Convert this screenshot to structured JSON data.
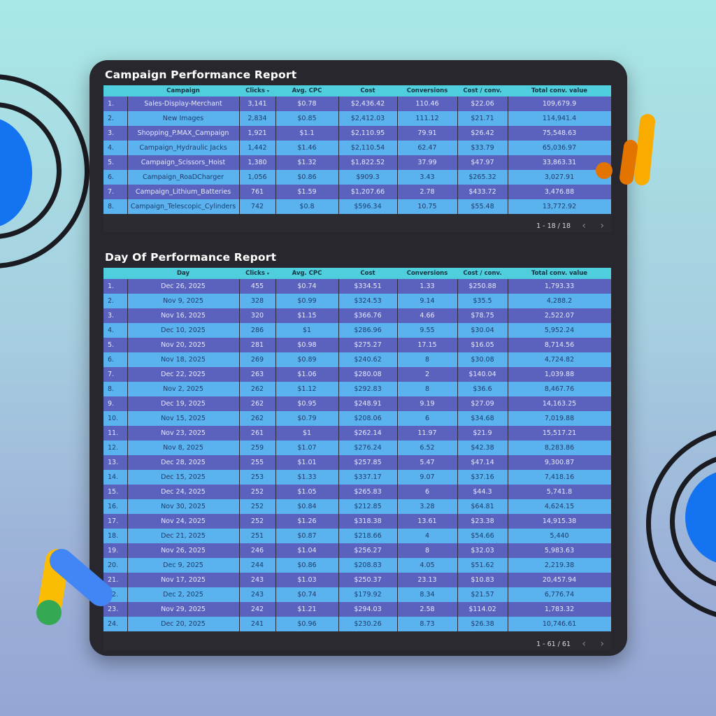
{
  "colors": {
    "panel": "#27272d",
    "header": "#4fcfde",
    "row_dark": "#5b62bd",
    "row_light": "#5ab2ee",
    "ads_blue": "#4285f4",
    "ads_yellow": "#fbbc04",
    "ads_green": "#34a853",
    "analytics_orange": "#e37400",
    "analytics_yellow": "#f9ab00"
  },
  "icons": {
    "google_ads": "google-ads-logo",
    "google_analytics": "google-analytics-logo",
    "prev": "chevron-left-icon",
    "next": "chevron-right-icon",
    "sort": "sort-down-icon"
  },
  "campaign_report": {
    "title": "Campaign Performance Report",
    "columns": [
      "Campaign",
      "Clicks",
      "Avg. CPC",
      "Cost",
      "Conversions",
      "Cost / conv.",
      "Total conv. value"
    ],
    "sort_marker": "▾",
    "rows": [
      [
        "1.",
        "Sales-Display-Merchant",
        "3,141",
        "$0.78",
        "$2,436.42",
        "110.46",
        "$22.06",
        "109,679.9"
      ],
      [
        "2.",
        "New Images",
        "2,834",
        "$0.85",
        "$2,412.03",
        "111.12",
        "$21.71",
        "114,941.4"
      ],
      [
        "3.",
        "Shopping_P.MAX_Campaign",
        "1,921",
        "$1.1",
        "$2,110.95",
        "79.91",
        "$26.42",
        "75,548.63"
      ],
      [
        "4.",
        "Campaign_Hydraulic Jacks",
        "1,442",
        "$1.46",
        "$2,110.54",
        "62.47",
        "$33.79",
        "65,036.97"
      ],
      [
        "5.",
        "Campaign_Scissors_Hoist",
        "1,380",
        "$1.32",
        "$1,822.52",
        "37.99",
        "$47.97",
        "33,863.31"
      ],
      [
        "6.",
        "Campaign_RoaDCharger",
        "1,056",
        "$0.86",
        "$909.3",
        "3.43",
        "$265.32",
        "3,027.91"
      ],
      [
        "7.",
        "Campaign_Lithium_Batteries",
        "761",
        "$1.59",
        "$1,207.66",
        "2.78",
        "$433.72",
        "3,476.88"
      ],
      [
        "8.",
        "Campaign_Telescopic_Cylinders",
        "742",
        "$0.8",
        "$596.34",
        "10.75",
        "$55.48",
        "13,772.92"
      ]
    ],
    "pager": "1 - 18 / 18"
  },
  "day_report": {
    "title": "Day Of Performance Report",
    "columns": [
      "Day",
      "Clicks",
      "Avg. CPC",
      "Cost",
      "Conversions",
      "Cost / conv.",
      "Total conv. value"
    ],
    "sort_marker": "▾",
    "rows": [
      [
        "1.",
        "Dec 26, 2025",
        "455",
        "$0.74",
        "$334.51",
        "1.33",
        "$250.88",
        "1,793.33"
      ],
      [
        "2.",
        "Nov 9, 2025",
        "328",
        "$0.99",
        "$324.53",
        "9.14",
        "$35.5",
        "4,288.2"
      ],
      [
        "3.",
        "Nov 16, 2025",
        "320",
        "$1.15",
        "$366.76",
        "4.66",
        "$78.75",
        "2,522.07"
      ],
      [
        "4.",
        "Dec 10, 2025",
        "286",
        "$1",
        "$286.96",
        "9.55",
        "$30.04",
        "5,952.24"
      ],
      [
        "5.",
        "Nov 20, 2025",
        "281",
        "$0.98",
        "$275.27",
        "17.15",
        "$16.05",
        "8,714.56"
      ],
      [
        "6.",
        "Nov 18, 2025",
        "269",
        "$0.89",
        "$240.62",
        "8",
        "$30.08",
        "4,724.82"
      ],
      [
        "7.",
        "Dec 22, 2025",
        "263",
        "$1.06",
        "$280.08",
        "2",
        "$140.04",
        "1,039.88"
      ],
      [
        "8.",
        "Nov 2, 2025",
        "262",
        "$1.12",
        "$292.83",
        "8",
        "$36.6",
        "8,467.76"
      ],
      [
        "9.",
        "Dec 19, 2025",
        "262",
        "$0.95",
        "$248.91",
        "9.19",
        "$27.09",
        "14,163.25"
      ],
      [
        "10.",
        "Nov 15, 2025",
        "262",
        "$0.79",
        "$208.06",
        "6",
        "$34.68",
        "7,019.88"
      ],
      [
        "11.",
        "Nov 23, 2025",
        "261",
        "$1",
        "$262.14",
        "11.97",
        "$21.9",
        "15,517.21"
      ],
      [
        "12.",
        "Nov 8, 2025",
        "259",
        "$1.07",
        "$276.24",
        "6.52",
        "$42.38",
        "8,283.86"
      ],
      [
        "13.",
        "Dec 28, 2025",
        "255",
        "$1.01",
        "$257.85",
        "5.47",
        "$47.14",
        "9,300.87"
      ],
      [
        "14.",
        "Dec 15, 2025",
        "253",
        "$1.33",
        "$337.17",
        "9.07",
        "$37.16",
        "7,418.16"
      ],
      [
        "15.",
        "Dec 24, 2025",
        "252",
        "$1.05",
        "$265.83",
        "6",
        "$44.3",
        "5,741.8"
      ],
      [
        "16.",
        "Nov 30, 2025",
        "252",
        "$0.84",
        "$212.85",
        "3.28",
        "$64.81",
        "4,624.15"
      ],
      [
        "17.",
        "Nov 24, 2025",
        "252",
        "$1.26",
        "$318.38",
        "13.61",
        "$23.38",
        "14,915.38"
      ],
      [
        "18.",
        "Dec 21, 2025",
        "251",
        "$0.87",
        "$218.66",
        "4",
        "$54.66",
        "5,440"
      ],
      [
        "19.",
        "Nov 26, 2025",
        "246",
        "$1.04",
        "$256.27",
        "8",
        "$32.03",
        "5,983.63"
      ],
      [
        "20.",
        "Dec 9, 2025",
        "244",
        "$0.86",
        "$208.83",
        "4.05",
        "$51.62",
        "2,219.38"
      ],
      [
        "21.",
        "Nov 17, 2025",
        "243",
        "$1.03",
        "$250.37",
        "23.13",
        "$10.83",
        "20,457.94"
      ],
      [
        "22.",
        "Dec 2, 2025",
        "243",
        "$0.74",
        "$179.92",
        "8.34",
        "$21.57",
        "6,776.74"
      ],
      [
        "23.",
        "Nov 29, 2025",
        "242",
        "$1.21",
        "$294.03",
        "2.58",
        "$114.02",
        "1,783.32"
      ],
      [
        "24.",
        "Dec 20, 2025",
        "241",
        "$0.96",
        "$230.26",
        "8.73",
        "$26.38",
        "10,746.61"
      ]
    ],
    "pager": "1 - 61 / 61"
  },
  "pager_icons": {
    "prev": "‹",
    "next": "›"
  }
}
